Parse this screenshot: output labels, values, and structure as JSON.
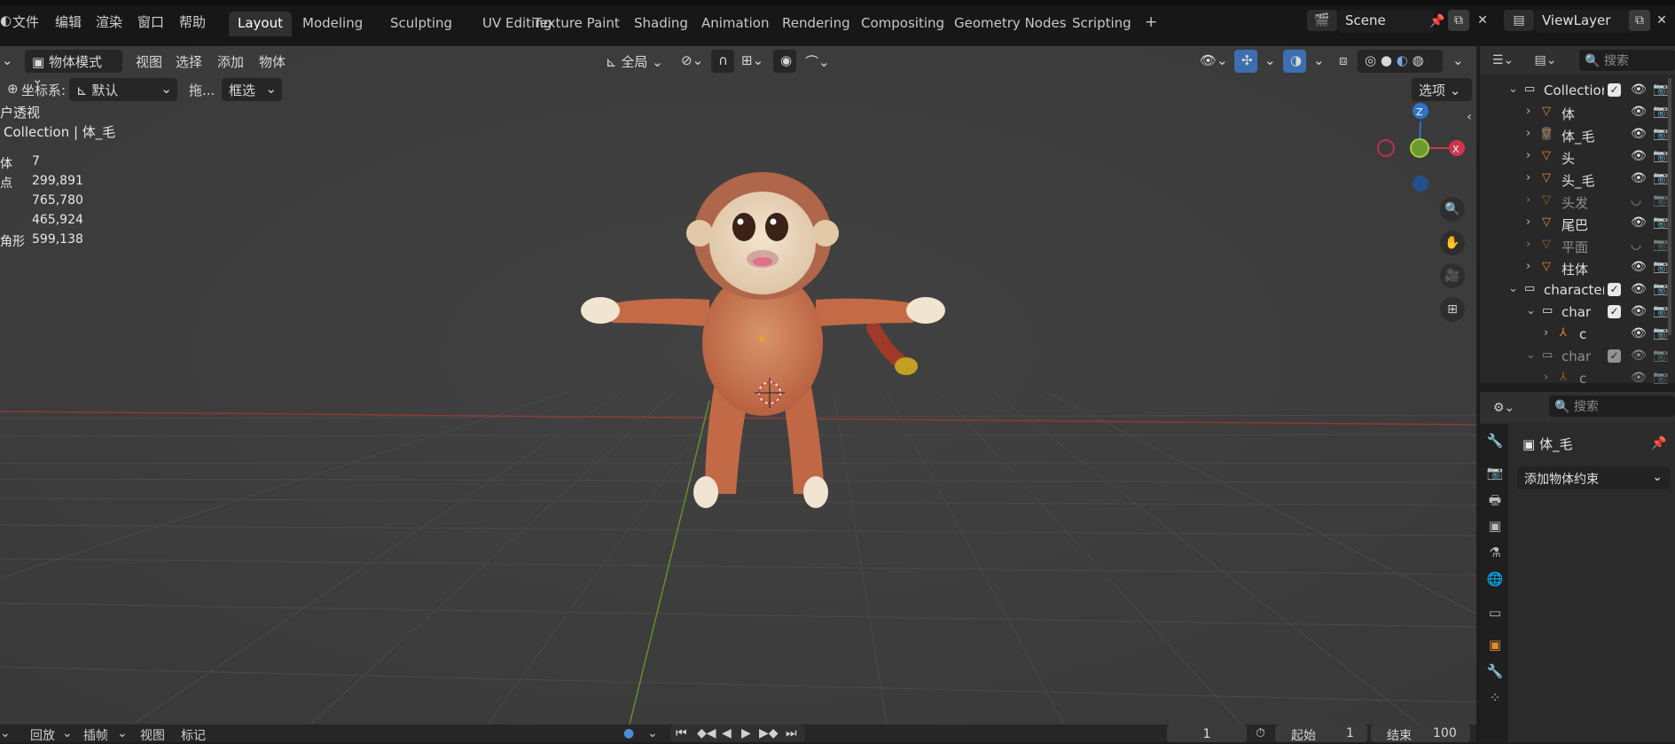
{
  "menu": {
    "file": "文件",
    "edit": "编辑",
    "render": "渲染",
    "window": "窗口",
    "help": "帮助"
  },
  "workspaces": [
    "Layout",
    "Modeling",
    "Sculpting",
    "UV Editing",
    "Texture Paint",
    "Shading",
    "Animation",
    "Rendering",
    "Compositing",
    "Geometry Nodes",
    "Scripting"
  ],
  "add_tab": "+",
  "scene": {
    "label": "Scene"
  },
  "view_layer": {
    "label": "ViewLayer"
  },
  "viewport": {
    "mode": "物体模式",
    "menus": [
      "视图",
      "选择",
      "添加",
      "物体"
    ],
    "transform_orientation": "全局",
    "coord_label": "坐标系:",
    "coord_value": "默认",
    "drag_label": "拖...",
    "select_mode": "框选",
    "options": "选项",
    "view_name": "户透视",
    "breadcrumb": "Collection | 体_毛",
    "stats": [
      {
        "label": "体",
        "value": "7"
      },
      {
        "label": "点",
        "value": "299,891"
      },
      {
        "label": "",
        "value": "765,780"
      },
      {
        "label": "",
        "value": "465,924"
      },
      {
        "label": "角形",
        "value": "599,138"
      }
    ],
    "gizmo": {
      "z": "Z",
      "x": "X"
    }
  },
  "timeline": {
    "playback": "回放",
    "keying": "插帧",
    "view": "视图",
    "marker": "标记",
    "current_frame": "1",
    "start_label": "起始",
    "start_value": "1",
    "end_label": "结束",
    "end_value": "100"
  },
  "outliner": {
    "search_placeholder": "搜索",
    "rows": [
      {
        "name": "Collection",
        "type": "collection",
        "indent": 0,
        "expanded": true,
        "dim": false
      },
      {
        "name": "体",
        "type": "mesh",
        "indent": 1,
        "expanded": false,
        "dim": false
      },
      {
        "name": "体_毛",
        "type": "mesh",
        "indent": 1,
        "expanded": false,
        "dim": false,
        "active": true
      },
      {
        "name": "头",
        "type": "mesh",
        "indent": 1,
        "expanded": false,
        "dim": false
      },
      {
        "name": "头_毛",
        "type": "mesh",
        "indent": 1,
        "expanded": false,
        "dim": false
      },
      {
        "name": "头发",
        "type": "mesh",
        "indent": 1,
        "expanded": false,
        "dim": true
      },
      {
        "name": "尾巴",
        "type": "mesh",
        "indent": 1,
        "expanded": false,
        "dim": false
      },
      {
        "name": "平面",
        "type": "mesh",
        "indent": 1,
        "expanded": false,
        "dim": true
      },
      {
        "name": "柱体",
        "type": "mesh",
        "indent": 1,
        "expanded": false,
        "dim": false
      },
      {
        "name": "character",
        "type": "collection",
        "indent": 0,
        "expanded": true,
        "dim": false
      },
      {
        "name": "char",
        "type": "collection",
        "indent": 1,
        "expanded": true,
        "dim": false
      },
      {
        "name": "c",
        "type": "armature",
        "indent": 2,
        "expanded": false,
        "dim": false
      },
      {
        "name": "char",
        "type": "collection",
        "indent": 1,
        "expanded": true,
        "dim": true
      },
      {
        "name": "c",
        "type": "armature",
        "indent": 2,
        "expanded": false,
        "dim": true
      }
    ]
  },
  "properties": {
    "search_placeholder": "搜索",
    "object_name": "体_毛",
    "add_constraint": "添加物体约束"
  }
}
